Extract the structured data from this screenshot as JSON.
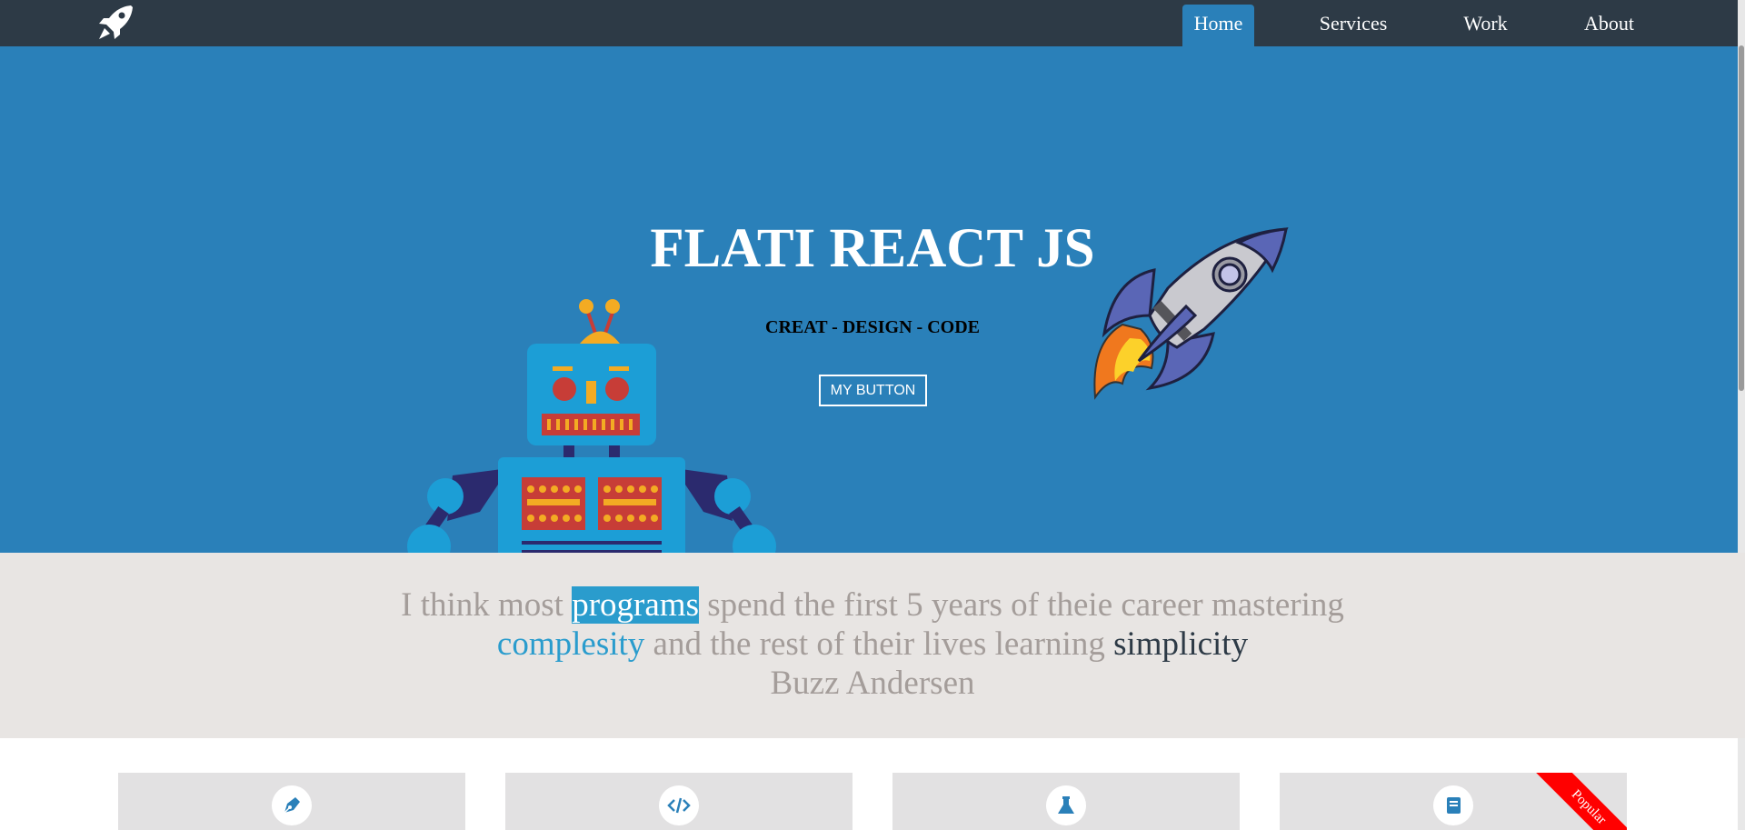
{
  "nav": {
    "logo_icon": "rocket-logo-icon",
    "items": [
      {
        "label": "Home",
        "active": true
      },
      {
        "label": "Services",
        "active": false
      },
      {
        "label": "Work",
        "active": false
      },
      {
        "label": "About",
        "active": false
      }
    ]
  },
  "hero": {
    "title": "FLATI REACT JS",
    "subtitle": "CREAT - DESIGN - CODE",
    "button_label": "MY BUTTON",
    "background": "#2a80b9",
    "illustrations": [
      "robot-illustration",
      "rocket-illustration"
    ]
  },
  "quote": {
    "part1": "I think most ",
    "highlight": "programs",
    "part2": " spend the first 5 years of theie career mastering",
    "blue_word": "complesity",
    "part3": " and the rest of their lives learning ",
    "dark_word": "simplicity",
    "author": "Buzz Andersen"
  },
  "cards": [
    {
      "icon": "pen-icon"
    },
    {
      "icon": "code-icon"
    },
    {
      "icon": "flask-icon"
    },
    {
      "icon": "book-icon",
      "ribbon": "Popular"
    }
  ],
  "colors": {
    "topbar": "#2d3a46",
    "accent": "#2a9ccd",
    "quote_bg": "#e8e5e3",
    "ribbon": "#ff0000"
  }
}
